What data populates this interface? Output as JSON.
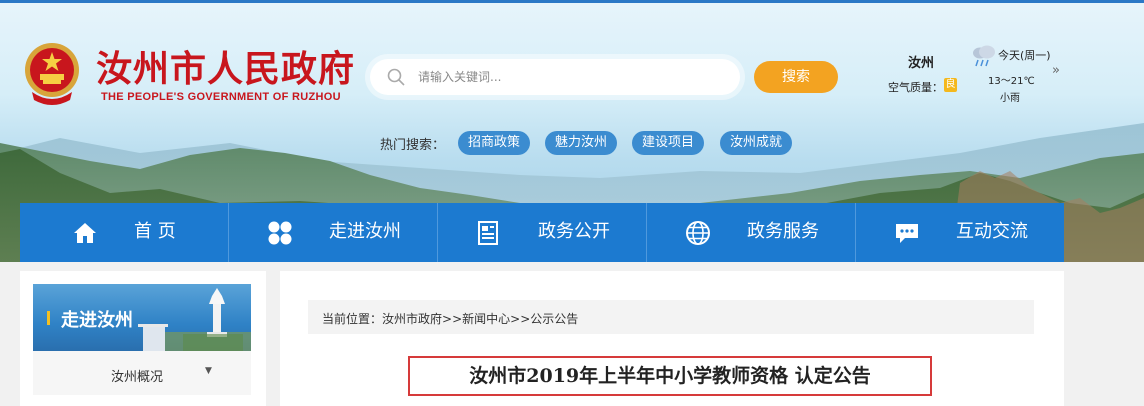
{
  "header": {
    "site_title": "汝州市人民政府",
    "site_subtitle": "THE PEOPLE'S GOVERNMENT OF RUZHOU",
    "search": {
      "placeholder": "请输入关键词...",
      "button_label": "搜索",
      "icon": "search-icon"
    },
    "weather": {
      "city": "汝州",
      "air_quality_label": "空气质量：",
      "air_quality_value": "良",
      "day": "今天(周一)",
      "temperature": "13～21℃",
      "condition": "小雨",
      "icon": "rain-cloud-icon",
      "more_icon": "»"
    },
    "hot_search": {
      "label": "热门搜索：",
      "tags": [
        "招商政策",
        "魅力汝州",
        "建设项目",
        "汝州成就"
      ]
    }
  },
  "nav": {
    "items": [
      {
        "label": "首  页",
        "icon": "home-icon"
      },
      {
        "label": "走进汝州",
        "icon": "grid-icon"
      },
      {
        "label": "政务公开",
        "icon": "document-icon"
      },
      {
        "label": "政务服务",
        "icon": "globe-icon"
      },
      {
        "label": "互动交流",
        "icon": "chat-icon"
      }
    ]
  },
  "sidebar": {
    "title": "走进汝州",
    "items": [
      {
        "label": "汝州概况",
        "arrow": "▼"
      }
    ]
  },
  "main": {
    "breadcrumb": {
      "prefix": "当前位置：",
      "items": [
        "汝州市政府",
        "新闻中心",
        "公示公告"
      ],
      "separator": ">>"
    },
    "article_title": "汝州市2019年上半年中小学教师资格  认定公告"
  },
  "colors": {
    "brand_red": "#c8161d",
    "nav_blue": "#1c7ad0",
    "tag_blue": "#3b8cd0",
    "search_orange": "#f3a321",
    "title_border": "#d63a3a"
  }
}
